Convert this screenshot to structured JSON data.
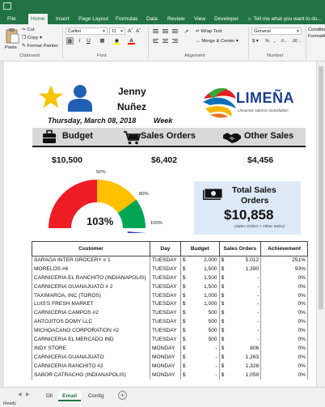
{
  "ribbon_tabs": [
    "File",
    "Home",
    "Insert",
    "Page Layout",
    "Formulas",
    "Data",
    "Review",
    "View",
    "Developer"
  ],
  "tell_me": "Tell me what you want to do...",
  "ribbon": {
    "paste": "Paste",
    "cut": "Cut",
    "copy": "Copy",
    "format_painter": "Format Painter",
    "clipboard": "Clipboard",
    "font_name": "Calibri",
    "font_size": "11",
    "font_group": "Font",
    "wrap_text": "Wrap Text",
    "merge_center": "Merge & Center",
    "alignment": "Alignment",
    "number_format": "General",
    "number_group": "Number",
    "conditional_formatting": "Conditional Formatting"
  },
  "dashboard": {
    "name_first": "Jenny",
    "name_last": "Nuñez",
    "date": "Thursday, March 08, 2018",
    "period": "Week",
    "logo_text": "LIMEÑA",
    "logo_tagline": "Llenamos sabores inolvidables",
    "kpis": {
      "budget_label": "Budget",
      "sales_orders_label": "Sales Orders",
      "other_sales_label": "Other Sales",
      "budget_value": "$10,500",
      "sales_orders_value": "$6,402",
      "other_sales_value": "$4,456"
    },
    "gauge": {
      "value_label": "103%",
      "achievement": 1.03,
      "tick_50": "50%",
      "tick_80": "80%",
      "tick_100": "100%",
      "colors": {
        "red": "#ee1c25",
        "yellow": "#ffc000",
        "green": "#00a651",
        "needle": "#3333cc"
      }
    },
    "total": {
      "title_line1": "Total Sales",
      "title_line2": "Orders",
      "value": "$10,858",
      "note": "(Sales Orders + Other Sales)"
    }
  },
  "table": {
    "headers": [
      "Customer",
      "Day",
      "Budget",
      "Sales Orders",
      "Achievement"
    ],
    "rows": [
      {
        "customer": "SARAGA INTER GROCERY # 1",
        "day": "TUESDAY",
        "budget_cur": "$",
        "budget": "2,000",
        "sales_cur": "$",
        "sales": "5,012",
        "ach": "251%"
      },
      {
        "customer": "MORELOS #6",
        "day": "TUESDAY",
        "budget_cur": "$",
        "budget": "1,500",
        "sales_cur": "$",
        "sales": "1,390",
        "ach": "93%"
      },
      {
        "customer": "CARNICERIA EL RANCHITO (INDIANAPOLIS)",
        "day": "TUESDAY",
        "budget_cur": "$",
        "budget": "1,500",
        "sales_cur": "$",
        "sales": "-",
        "ach": "0%"
      },
      {
        "customer": "CARNICERIA GUANAJUATO # 2",
        "day": "TUESDAY",
        "budget_cur": "$",
        "budget": "1,500",
        "sales_cur": "$",
        "sales": "-",
        "ach": "0%"
      },
      {
        "customer": "TAXIMAROA, INC (TOROS)",
        "day": "TUESDAY",
        "budget_cur": "$",
        "budget": "1,000",
        "sales_cur": "$",
        "sales": "-",
        "ach": "0%"
      },
      {
        "customer": "LUIS'S FRESH MARKET",
        "day": "TUESDAY",
        "budget_cur": "$",
        "budget": "1,000",
        "sales_cur": "$",
        "sales": "-",
        "ach": "0%"
      },
      {
        "customer": "CARNICERIA CAMPOS #2",
        "day": "TUESDAY",
        "budget_cur": "$",
        "budget": "500",
        "sales_cur": "$",
        "sales": "-",
        "ach": "0%"
      },
      {
        "customer": "ANTOJITOS DOMY LLC",
        "day": "TUESDAY",
        "budget_cur": "$",
        "budget": "500",
        "sales_cur": "$",
        "sales": "-",
        "ach": "0%"
      },
      {
        "customer": "MICHOACANO CORPORATION #2",
        "day": "TUESDAY",
        "budget_cur": "$",
        "budget": "500",
        "sales_cur": "$",
        "sales": "-",
        "ach": "0%"
      },
      {
        "customer": "CARNICERIA EL MERCADO IND",
        "day": "TUESDAY",
        "budget_cur": "$",
        "budget": "500",
        "sales_cur": "$",
        "sales": "-",
        "ach": "0%"
      },
      {
        "customer": "INDY STORE",
        "day": "MONDAY",
        "budget_cur": "$",
        "budget": "-",
        "sales_cur": "$",
        "sales": "806",
        "ach": "0%"
      },
      {
        "customer": "CARNICERIA GUANAJUATO",
        "day": "MONDAY",
        "budget_cur": "$",
        "budget": "-",
        "sales_cur": "$",
        "sales": "1,263",
        "ach": "0%"
      },
      {
        "customer": "CARNICERIA RANCHITO #2",
        "day": "MONDAY",
        "budget_cur": "$",
        "budget": "-",
        "sales_cur": "$",
        "sales": "1,328",
        "ach": "0%"
      },
      {
        "customer": "SABOR CATRACHO (INDIANAPOLIS)",
        "day": "MONDAY",
        "budget_cur": "$",
        "budget": "-",
        "sales_cur": "$",
        "sales": "1,059",
        "ach": "0%"
      }
    ]
  },
  "sheet_tabs": [
    "Dll",
    "Email",
    "Config"
  ],
  "status": "Ready"
}
